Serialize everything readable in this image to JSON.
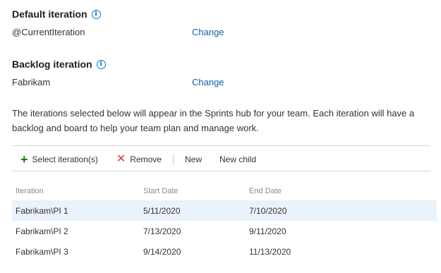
{
  "default_iteration": {
    "title": "Default iteration",
    "value": "@CurrentIteration",
    "change_label": "Change"
  },
  "backlog_iteration": {
    "title": "Backlog iteration",
    "value": "Fabrikam",
    "change_label": "Change"
  },
  "description": "The iterations selected below will appear in the Sprints hub for your team. Each iteration will have a backlog and board to help your team plan and manage work.",
  "toolbar": {
    "select_label": "Select iteration(s)",
    "remove_label": "Remove",
    "new_label": "New",
    "new_child_label": "New child"
  },
  "table": {
    "headers": [
      "Iteration",
      "Start Date",
      "End Date"
    ],
    "rows": [
      [
        "Fabrikam\\PI 1",
        "5/11/2020",
        "7/10/2020"
      ],
      [
        "Fabrikam\\PI 2",
        "7/13/2020",
        "9/11/2020"
      ],
      [
        "Fabrikam\\PI 3",
        "9/14/2020",
        "11/13/2020"
      ]
    ]
  },
  "icons": {
    "info": "info-icon",
    "add": "plus-icon",
    "remove": "close-icon"
  },
  "colors": {
    "link": "#1160a8",
    "add": "#107c10",
    "remove": "#d13438",
    "selected_row": "#eaf2fb"
  }
}
